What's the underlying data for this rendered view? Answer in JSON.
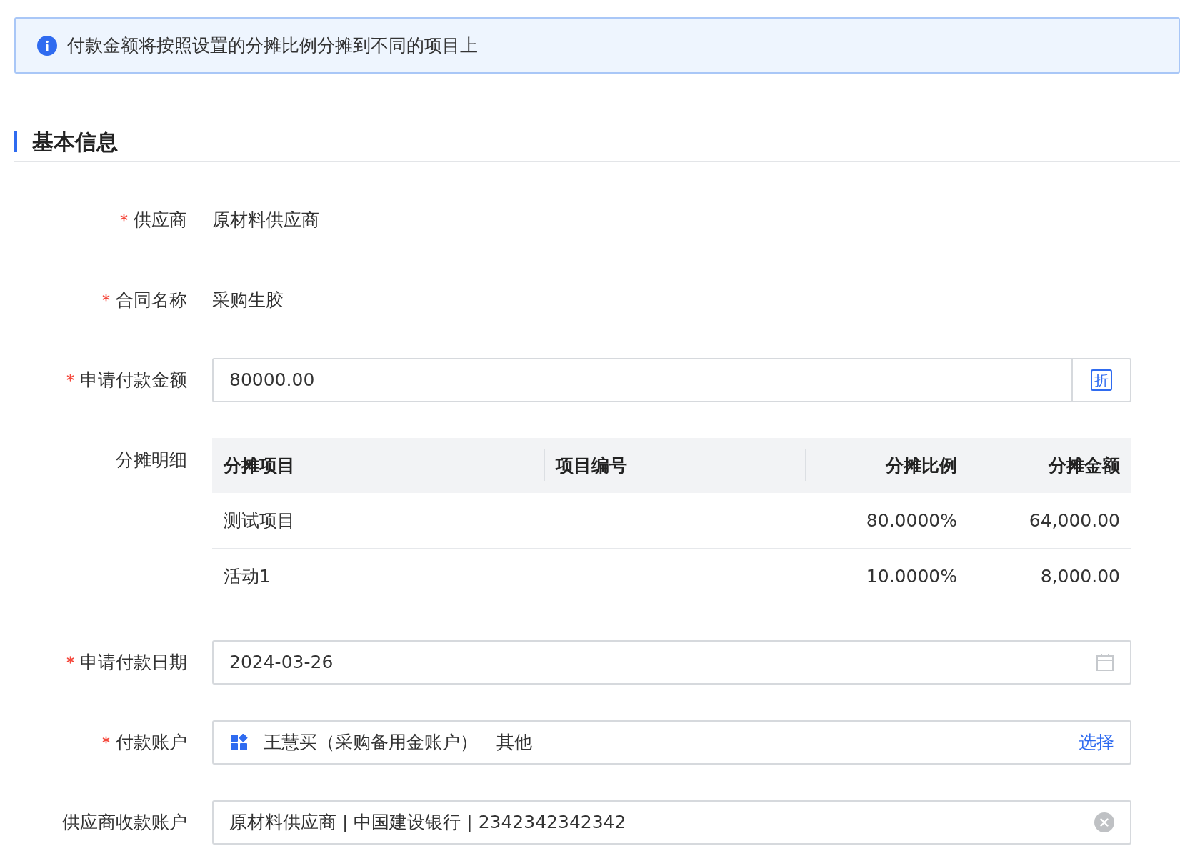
{
  "alert": {
    "text": "付款金额将按照设置的分摊比例分摊到不同的项目上"
  },
  "section": {
    "title": "基本信息"
  },
  "fields": [
    {
      "kind": "text",
      "label": "供应商",
      "required": true,
      "value": "原材料供应商"
    },
    {
      "kind": "text",
      "label": "合同名称",
      "required": true,
      "value": "采购生胶"
    },
    {
      "kind": "amount",
      "label": "申请付款金额",
      "required": true,
      "value": "80000.00",
      "addon": "折"
    },
    {
      "kind": "table",
      "label": "分摊明细",
      "required": false,
      "columns": [
        "分摊项目",
        "项目编号",
        "分摊比例",
        "分摊金额"
      ],
      "rows": [
        {
          "cells": [
            "测试项目",
            "",
            "80.0000%",
            "64,000.00"
          ]
        },
        {
          "cells": [
            "活动1",
            "",
            "10.0000%",
            "8,000.00"
          ]
        }
      ]
    },
    {
      "kind": "date",
      "label": "申请付款日期",
      "required": true,
      "value": "2024-03-26"
    },
    {
      "kind": "account",
      "label": "付款账户",
      "required": true,
      "value": "王慧买（采购备用金账户）",
      "tag": "其他",
      "action": "选择"
    },
    {
      "kind": "clearable",
      "label": "供应商收款账户",
      "required": false,
      "value": "原材料供应商 | 中国建设银行 | 2342342342342"
    }
  ]
}
